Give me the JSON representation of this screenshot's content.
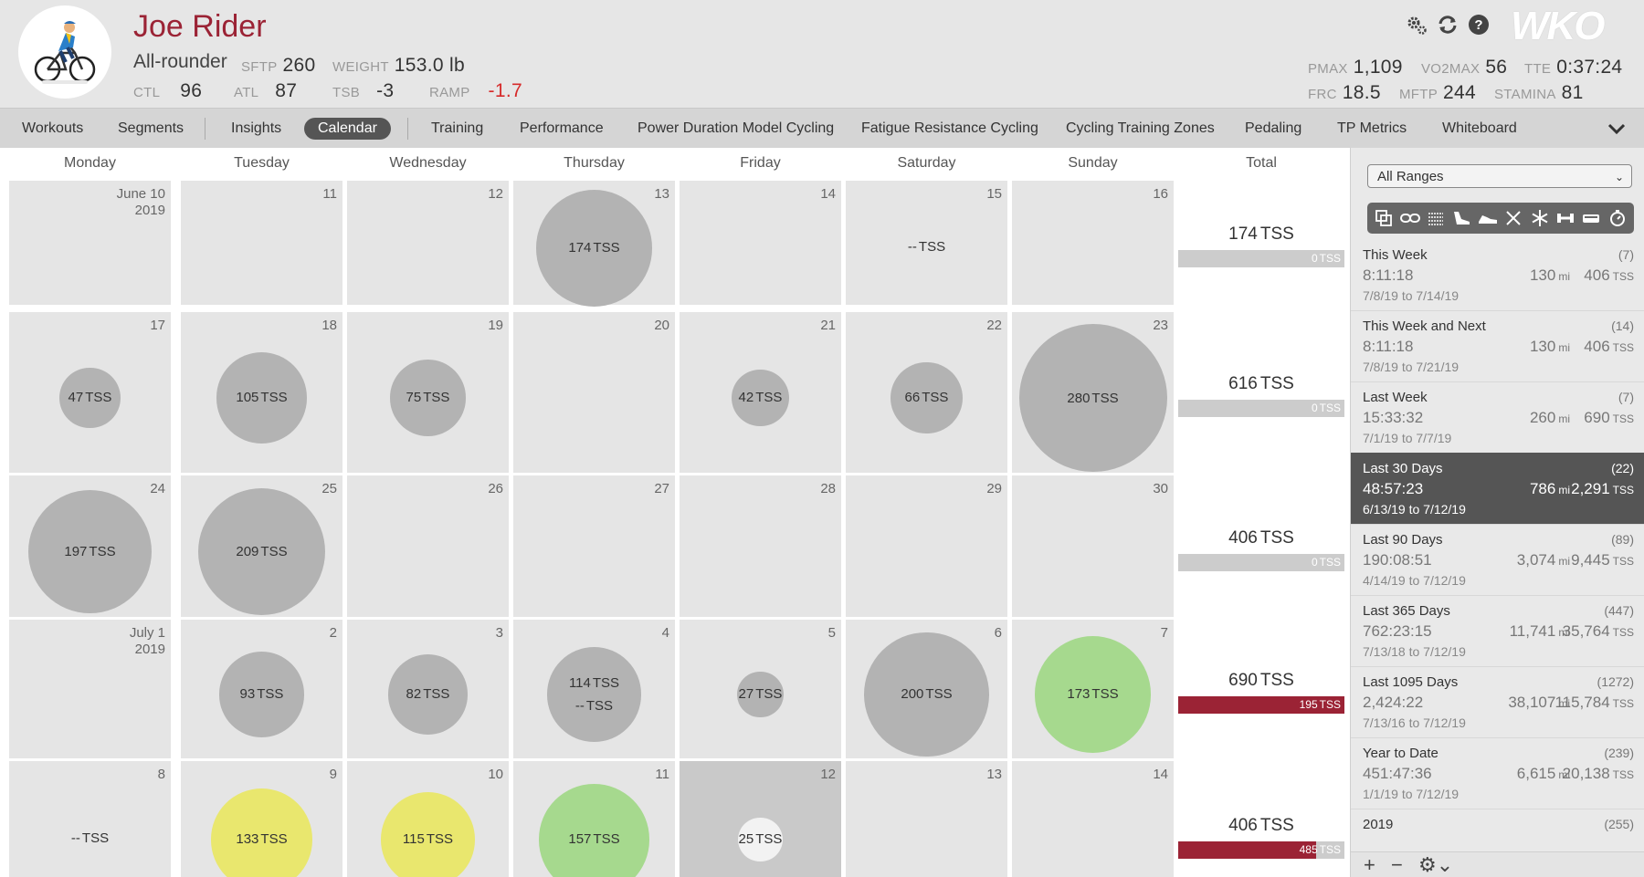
{
  "athlete": {
    "name": "Joe Rider",
    "phenotype": "All-rounder",
    "sftp_label": "SFTP",
    "sftp": "260",
    "weight_label": "WEIGHT",
    "weight": "153.0 lb",
    "ctl_label": "CTL",
    "ctl": "96",
    "atl_label": "ATL",
    "atl": "87",
    "tsb_label": "TSB",
    "tsb": "-3",
    "ramp_label": "RAMP",
    "ramp": "-1.7",
    "pmax_label": "PMAX",
    "pmax": "1,109",
    "vo2max_label": "VO2MAX",
    "vo2max": "56",
    "tte_label": "TTE",
    "tte": "0:37:24",
    "frc_label": "FRC",
    "frc": "18.5",
    "mftp_label": "MFTP",
    "mftp": "244",
    "stamina_label": "STAMINA",
    "stamina": "81"
  },
  "header_icons": [
    "gear-icon",
    "sync-icon",
    "help-icon"
  ],
  "logo_text": "WKO",
  "nav": {
    "tabs": [
      "Workouts",
      "Segments",
      "Insights",
      "Calendar",
      "Training",
      "Performance",
      "Power Duration Model Cycling",
      "Fatigue Resistance Cycling",
      "Cycling Training Zones",
      "Pedaling",
      "TP Metrics",
      "Whiteboard"
    ],
    "active": "Calendar"
  },
  "calendar": {
    "weekdays": [
      "Monday",
      "Tuesday",
      "Wednesday",
      "Thursday",
      "Friday",
      "Saturday",
      "Sunday",
      "Total"
    ],
    "tss_unit": "TSS",
    "weeks": [
      {
        "days": [
          {
            "label": "June 10",
            "sub": "2019",
            "tss": []
          },
          {
            "label": "11",
            "tss": []
          },
          {
            "label": "12",
            "tss": []
          },
          {
            "label": "13",
            "tss": [
              "174"
            ],
            "bubble": 174,
            "color": "#b3b3b3"
          },
          {
            "label": "14",
            "tss": []
          },
          {
            "label": "15",
            "tss": [
              "--"
            ]
          },
          {
            "label": "16",
            "tss": []
          }
        ],
        "total": "174",
        "planned": "0"
      },
      {
        "days": [
          {
            "label": "17",
            "tss": [
              "47"
            ],
            "bubble": 47,
            "color": "#b3b3b3"
          },
          {
            "label": "18",
            "tss": [
              "105"
            ],
            "bubble": 105,
            "color": "#b3b3b3"
          },
          {
            "label": "19",
            "tss": [
              "75"
            ],
            "bubble": 75,
            "color": "#b3b3b3"
          },
          {
            "label": "20",
            "tss": []
          },
          {
            "label": "21",
            "tss": [
              "42"
            ],
            "bubble": 42,
            "color": "#b3b3b3"
          },
          {
            "label": "22",
            "tss": [
              "66"
            ],
            "bubble": 66,
            "color": "#b3b3b3"
          },
          {
            "label": "23",
            "tss": [
              "280"
            ],
            "bubble": 280,
            "color": "#b3b3b3"
          }
        ],
        "total": "616",
        "planned": "0"
      },
      {
        "days": [
          {
            "label": "24",
            "tss": [
              "197"
            ],
            "bubble": 197,
            "color": "#b3b3b3"
          },
          {
            "label": "25",
            "tss": [
              "209"
            ],
            "bubble": 209,
            "color": "#b3b3b3"
          },
          {
            "label": "26",
            "tss": []
          },
          {
            "label": "27",
            "tss": []
          },
          {
            "label": "28",
            "tss": []
          },
          {
            "label": "29",
            "tss": []
          },
          {
            "label": "30",
            "tss": []
          }
        ],
        "total": "406",
        "planned": "0"
      },
      {
        "days": [
          {
            "label": "July 1",
            "sub": "2019",
            "tss": []
          },
          {
            "label": "2",
            "tss": [
              "93"
            ],
            "bubble": 93,
            "color": "#b3b3b3"
          },
          {
            "label": "3",
            "tss": [
              "82"
            ],
            "bubble": 82,
            "color": "#b3b3b3"
          },
          {
            "label": "4",
            "tss": [
              "114",
              "--"
            ],
            "bubble": 114,
            "color": "#b3b3b3"
          },
          {
            "label": "5",
            "tss": [
              "27"
            ],
            "bubble": 27,
            "color": "#b3b3b3"
          },
          {
            "label": "6",
            "tss": [
              "200"
            ],
            "bubble": 200,
            "color": "#b3b3b3"
          },
          {
            "label": "7",
            "tss": [
              "173"
            ],
            "bubble": 173,
            "color": "#a6d98e"
          }
        ],
        "total": "690",
        "planned": "195",
        "planned_ratio": 1.0
      },
      {
        "days": [
          {
            "label": "8",
            "tss": [
              "--"
            ]
          },
          {
            "label": "9",
            "tss": [
              "133"
            ],
            "bubble": 133,
            "color": "#e9e76e"
          },
          {
            "label": "10",
            "tss": [
              "115"
            ],
            "bubble": 115,
            "color": "#e9e76e"
          },
          {
            "label": "11",
            "tss": [
              "157"
            ],
            "bubble": 157,
            "color": "#a6d98e"
          },
          {
            "label": "12",
            "tss": [
              "25"
            ],
            "bubble": 25,
            "color": "#f2f2f2",
            "today": true
          },
          {
            "label": "13",
            "tss": []
          },
          {
            "label": "14",
            "tss": []
          }
        ],
        "total": "406",
        "planned": "485",
        "planned_ratio": 0.83
      }
    ]
  },
  "sidebar": {
    "range_select": "All Ranges",
    "filter_icons": [
      "copy-icon",
      "chain-icon",
      "swim-icon",
      "run-shoe-icon",
      "shoe-icon",
      "ski-icon",
      "snowflake-icon",
      "strength-icon",
      "rowing-icon",
      "stopwatch-icon"
    ],
    "ranges": [
      {
        "name": "This Week",
        "count": "(7)",
        "duration": "8:11:18",
        "distance": "130",
        "dist_unit": "mi",
        "tss": "406",
        "tss_unit": "TSS",
        "dates": "7/8/19 to 7/14/19"
      },
      {
        "name": "This Week and Next",
        "count": "(14)",
        "duration": "8:11:18",
        "distance": "130",
        "dist_unit": "mi",
        "tss": "406",
        "tss_unit": "TSS",
        "dates": "7/8/19 to 7/21/19"
      },
      {
        "name": "Last Week",
        "count": "(7)",
        "duration": "15:33:32",
        "distance": "260",
        "dist_unit": "mi",
        "tss": "690",
        "tss_unit": "TSS",
        "dates": "7/1/19 to 7/7/19"
      },
      {
        "name": "Last 30 Days",
        "count": "(22)",
        "duration": "48:57:23",
        "distance": "786",
        "dist_unit": "mi",
        "tss": "2,291",
        "tss_unit": "TSS",
        "dates": "6/13/19 to 7/12/19",
        "selected": true
      },
      {
        "name": "Last 90 Days",
        "count": "(89)",
        "duration": "190:08:51",
        "distance": "3,074",
        "dist_unit": "mi",
        "tss": "9,445",
        "tss_unit": "TSS",
        "dates": "4/14/19 to 7/12/19"
      },
      {
        "name": "Last 365 Days",
        "count": "(447)",
        "duration": "762:23:15",
        "distance": "11,741",
        "dist_unit": "mi",
        "tss": "35,764",
        "tss_unit": "TSS",
        "dates": "7/13/18 to 7/12/19"
      },
      {
        "name": "Last 1095 Days",
        "count": "(1272)",
        "duration": "2,424:22",
        "distance": "38,107",
        "dist_unit": "mi",
        "tss": "115,784",
        "tss_unit": "TSS",
        "dates": "7/13/16 to 7/12/19"
      },
      {
        "name": "Year to Date",
        "count": "(239)",
        "duration": "451:47:36",
        "distance": "6,615",
        "dist_unit": "mi",
        "tss": "20,138",
        "tss_unit": "TSS",
        "dates": "1/1/19 to 7/12/19"
      },
      {
        "name": "2019",
        "count": "(255)",
        "duration": "",
        "distance": "",
        "dist_unit": "",
        "tss": "",
        "tss_unit": "",
        "dates": ""
      }
    ],
    "footer_icons": [
      "add-icon",
      "remove-icon",
      "settings-menu-icon"
    ]
  }
}
